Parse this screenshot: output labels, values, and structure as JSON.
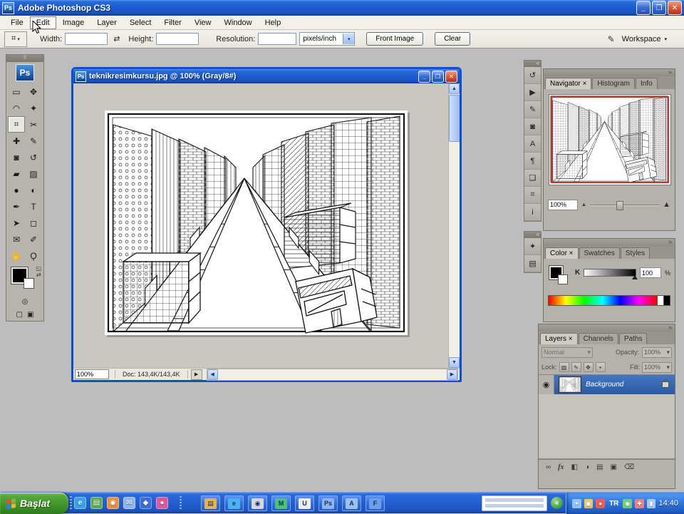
{
  "titlebar": {
    "title": "Adobe Photoshop CS3",
    "logo": "Ps"
  },
  "window_controls": {
    "minimize": "_",
    "maximize": "❐",
    "close": "✕"
  },
  "menubar": {
    "items": [
      "File",
      "Edit",
      "Image",
      "Layer",
      "Select",
      "Filter",
      "View",
      "Window",
      "Help"
    ]
  },
  "optionsbar": {
    "tool_icon": "⌗",
    "tool_arrow": "▾",
    "width_label": "Width:",
    "swap_icon": "⇄",
    "height_label": "Height:",
    "resolution_label": "Resolution:",
    "unit": "pixels/inch",
    "front_image_button": "Front Image",
    "clear_button": "Clear",
    "brush_icon": "✎",
    "workspace_button": "Workspace",
    "workspace_arrow": "▾"
  },
  "toolbox": {
    "grip": "⠿",
    "logo": "Ps",
    "reset_icon": "◱",
    "swap_icon": "⇄",
    "quickmask_icon": "◎",
    "screen_icons": [
      "▢",
      "▣"
    ],
    "tools": [
      {
        "name": "rectangular-marquee",
        "glyph": "▭"
      },
      {
        "name": "move",
        "glyph": "✥"
      },
      {
        "name": "lasso",
        "glyph": "◠"
      },
      {
        "name": "magic-wand",
        "glyph": "✦"
      },
      {
        "name": "crop",
        "glyph": "⌗"
      },
      {
        "name": "slice",
        "glyph": "✂"
      },
      {
        "name": "healing-brush",
        "glyph": "✚"
      },
      {
        "name": "brush",
        "glyph": "✎"
      },
      {
        "name": "clone-stamp",
        "glyph": "◙"
      },
      {
        "name": "history-brush",
        "glyph": "↺"
      },
      {
        "name": "eraser",
        "glyph": "▰"
      },
      {
        "name": "gradient",
        "glyph": "▨"
      },
      {
        "name": "blur",
        "glyph": "●"
      },
      {
        "name": "dodge",
        "glyph": "◐"
      },
      {
        "name": "pen",
        "glyph": "✒"
      },
      {
        "name": "type",
        "glyph": "T"
      },
      {
        "name": "path-selection",
        "glyph": "➤"
      },
      {
        "name": "shape",
        "glyph": "◻"
      },
      {
        "name": "notes",
        "glyph": "✉"
      },
      {
        "name": "eyedropper",
        "glyph": "✐"
      },
      {
        "name": "hand",
        "glyph": "✋"
      },
      {
        "name": "zoom",
        "glyph": "Ϙ"
      }
    ]
  },
  "dock": {
    "collapse_icon": "«",
    "group1": [
      {
        "name": "history",
        "glyph": "↺"
      },
      {
        "name": "actions",
        "glyph": "▶"
      },
      {
        "name": "brushes",
        "glyph": "✎"
      },
      {
        "name": "clone-source",
        "glyph": "◙"
      },
      {
        "name": "character",
        "glyph": "A"
      },
      {
        "name": "paragraph",
        "glyph": "¶"
      },
      {
        "name": "layer-comps",
        "glyph": "❏"
      },
      {
        "name": "tool-presets",
        "glyph": "⌗"
      },
      {
        "name": "info",
        "glyph": "i"
      }
    ],
    "group2": [
      {
        "name": "styles",
        "glyph": "✦"
      },
      {
        "name": "swatches",
        "glyph": "▤"
      }
    ]
  },
  "navigator": {
    "collapse_icon": "»",
    "tabs": [
      "Navigator ×",
      "Histogram",
      "Info"
    ],
    "zoom_value": "100%",
    "zoom_out_icon": "▲",
    "zoom_in_icon": "▲",
    "proxy_color": "#c8372a"
  },
  "color": {
    "collapse_icon": "»",
    "tabs": [
      "Color ×",
      "Swatches",
      "Styles"
    ],
    "channel_label": "K",
    "channel_value": "100",
    "percent_label": "%"
  },
  "layers": {
    "collapse_icon": "»",
    "tabs": [
      "Layers ×",
      "Channels",
      "Paths"
    ],
    "blend_mode": "Normal",
    "dropdown_arrow": "▾",
    "opacity_label": "Opacity:",
    "opacity_value": "100%",
    "lock_label": "Lock:",
    "lock_icons": [
      {
        "name": "lock-transparent",
        "glyph": "▨"
      },
      {
        "name": "lock-image",
        "glyph": "✎"
      },
      {
        "name": "lock-position",
        "glyph": "✥"
      },
      {
        "name": "lock-all",
        "glyph": "▪"
      }
    ],
    "fill_label": "Fill:",
    "fill_value": "100%",
    "eye_icon": "◉",
    "rows": [
      {
        "name": "Background"
      }
    ],
    "bottom_icons": [
      {
        "name": "link-layers",
        "glyph": "∞"
      },
      {
        "name": "layer-style",
        "glyph": "fx"
      },
      {
        "name": "add-layer-mask",
        "glyph": "◧"
      },
      {
        "name": "adjustment-layer",
        "glyph": "◑"
      },
      {
        "name": "new-group",
        "glyph": "▤"
      },
      {
        "name": "new-layer",
        "glyph": "▣"
      },
      {
        "name": "delete-layer",
        "glyph": "⌫"
      }
    ]
  },
  "document": {
    "title": "teknikresimkursu.jpg @ 100% (Gray/8#)",
    "logo": "Ps",
    "zoom_value": "100%",
    "doc_size": "Doc: 143,4K/143,4K",
    "status_arrow": "▶"
  },
  "scroll": {
    "up": "▲",
    "down": "▼",
    "left": "◀",
    "right": "▶"
  },
  "taskbar": {
    "start_label": "Başlat",
    "quick_launch": [
      {
        "name": "internet-explorer",
        "glyph": "e",
        "color": "#35a3e8"
      },
      {
        "name": "show-desktop",
        "glyph": "▤",
        "color": "#58b04c"
      },
      {
        "name": "media-player",
        "glyph": "◉",
        "color": "#e8913a"
      },
      {
        "name": "messenger",
        "glyph": "✉",
        "color": "#8fb4ec"
      },
      {
        "name": "app-blue",
        "glyph": "◆",
        "color": "#3a6fd8"
      },
      {
        "name": "app-pink",
        "glyph": "●",
        "color": "#d8589a"
      }
    ],
    "window_buttons": [
      {
        "glyph": "▤",
        "color": "#e8b34a"
      },
      {
        "glyph": "e",
        "color": "#49b4f0"
      },
      {
        "glyph": "◉",
        "color": "#d8d8d8"
      },
      {
        "glyph": "M",
        "color": "#4cc468"
      },
      {
        "glyph": "U",
        "color": "#eeeeee"
      },
      {
        "glyph": "Ps",
        "color": "#8fb4ec"
      },
      {
        "glyph": "A",
        "color": "#9cc0f0"
      },
      {
        "glyph": "F",
        "color": "#6f9fe8"
      }
    ],
    "chevron": "«",
    "tray_icons_left": [
      {
        "glyph": "✦",
        "color": "#8fc4f4"
      },
      {
        "glyph": "▣",
        "color": "#f0c468"
      },
      {
        "glyph": "●",
        "color": "#e86050"
      }
    ],
    "lang": "TR",
    "tray_icons_right": [
      {
        "glyph": "◉",
        "color": "#74d078"
      },
      {
        "glyph": "✚",
        "color": "#f08080"
      },
      {
        "glyph": "▮",
        "color": "#a8c8f0"
      }
    ],
    "clock": "14:40"
  }
}
